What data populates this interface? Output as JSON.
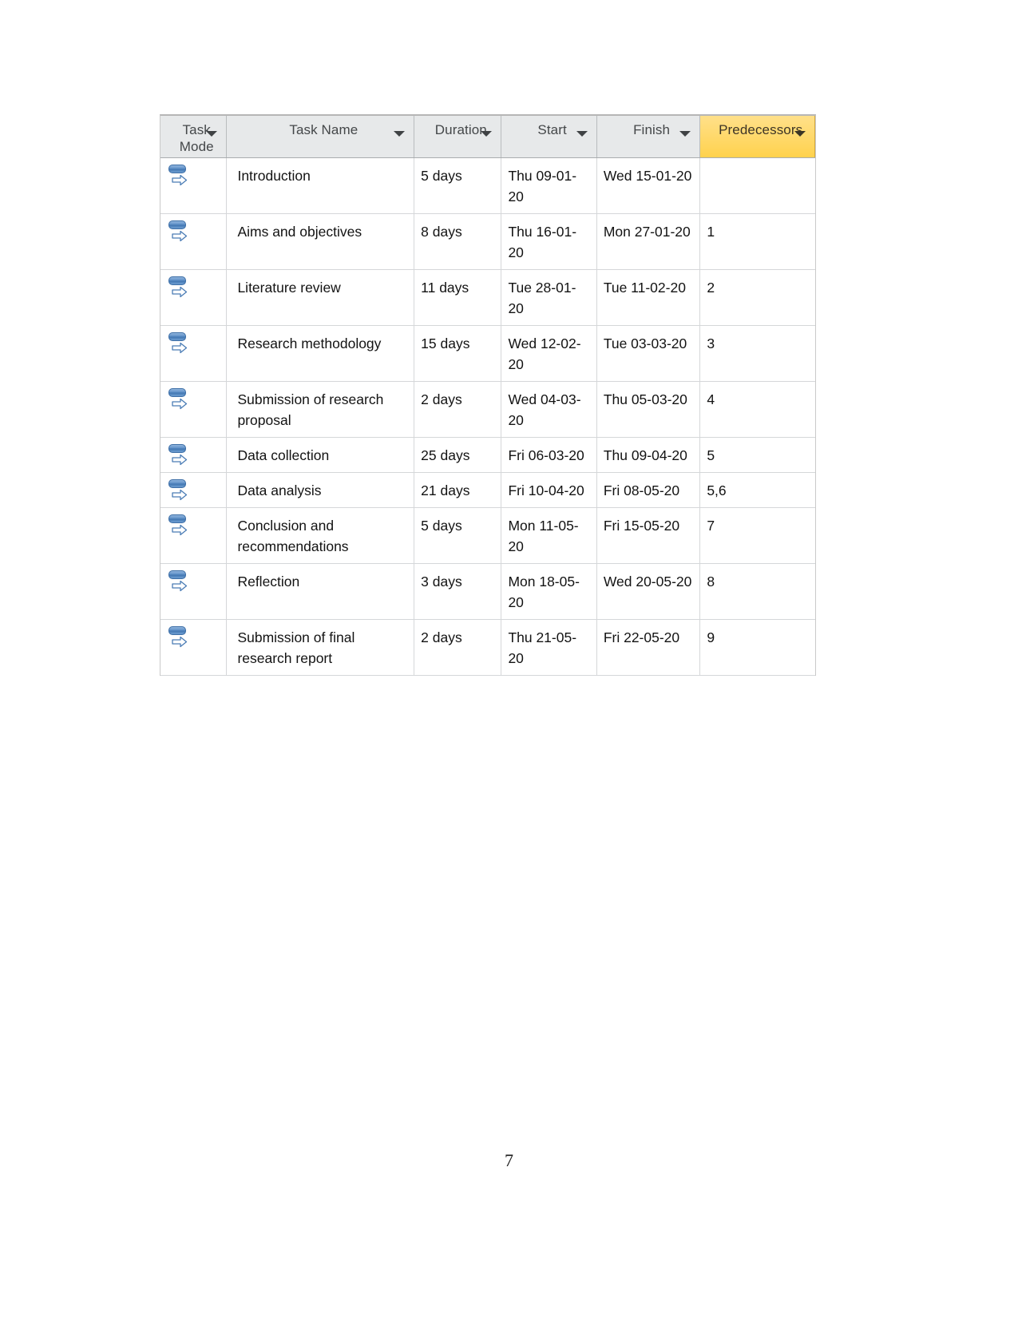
{
  "document": {
    "page_number": "7"
  },
  "task_table": {
    "columns": [
      {
        "key": "task_mode",
        "label": "Task\nMode",
        "highlighted": false,
        "has_filter": true
      },
      {
        "key": "task_name",
        "label": "Task Name",
        "highlighted": false,
        "has_filter": true
      },
      {
        "key": "duration",
        "label": "Duration",
        "highlighted": false,
        "has_filter": true
      },
      {
        "key": "start",
        "label": "Start",
        "highlighted": false,
        "has_filter": true
      },
      {
        "key": "finish",
        "label": "Finish",
        "highlighted": false,
        "has_filter": true
      },
      {
        "key": "predecessors",
        "label": "Predecessors",
        "highlighted": true,
        "has_filter": true
      }
    ],
    "header_highlight_color": "#ffd966",
    "header_background_color": "#e7e9ea",
    "task_mode_icon": "auto-scheduled-icon",
    "rows": [
      {
        "task_mode": "auto-scheduled-icon",
        "task_name": "Introduction",
        "duration": "5 days",
        "start": "Thu 09-01-20",
        "finish": "Wed 15-01-20",
        "predecessors": ""
      },
      {
        "task_mode": "auto-scheduled-icon",
        "task_name": "Aims and objectives",
        "duration": "8 days",
        "start": "Thu 16-01-20",
        "finish": "Mon 27-01-20",
        "predecessors": "1"
      },
      {
        "task_mode": "auto-scheduled-icon",
        "task_name": "Literature review",
        "duration": "11 days",
        "start": "Tue 28-01-20",
        "finish": "Tue 11-02-20",
        "predecessors": "2"
      },
      {
        "task_mode": "auto-scheduled-icon",
        "task_name": "Research methodology",
        "duration": "15 days",
        "start": "Wed 12-02-20",
        "finish": "Tue 03-03-20",
        "predecessors": "3"
      },
      {
        "task_mode": "auto-scheduled-icon",
        "task_name": "Submission of research proposal",
        "duration": "2 days",
        "start": "Wed 04-03-20",
        "finish": "Thu 05-03-20",
        "predecessors": "4"
      },
      {
        "task_mode": "auto-scheduled-icon",
        "task_name": "Data collection",
        "duration": "25 days",
        "start": "Fri 06-03-20",
        "finish": "Thu 09-04-20",
        "predecessors": "5"
      },
      {
        "task_mode": "auto-scheduled-icon",
        "task_name": "Data analysis",
        "duration": "21 days",
        "start": "Fri 10-04-20",
        "finish": "Fri 08-05-20",
        "predecessors": "5,6"
      },
      {
        "task_mode": "auto-scheduled-icon",
        "task_name": "Conclusion and recommendations",
        "duration": "5 days",
        "start": "Mon 11-05-20",
        "finish": "Fri 15-05-20",
        "predecessors": "7"
      },
      {
        "task_mode": "auto-scheduled-icon",
        "task_name": "Reflection",
        "duration": "3 days",
        "start": "Mon 18-05-20",
        "finish": "Wed 20-05-20",
        "predecessors": "8"
      },
      {
        "task_mode": "auto-scheduled-icon",
        "task_name": "Submission of final research report",
        "duration": "2 days",
        "start": "Thu 21-05-20",
        "finish": "Fri 22-05-20",
        "predecessors": "9"
      }
    ]
  }
}
